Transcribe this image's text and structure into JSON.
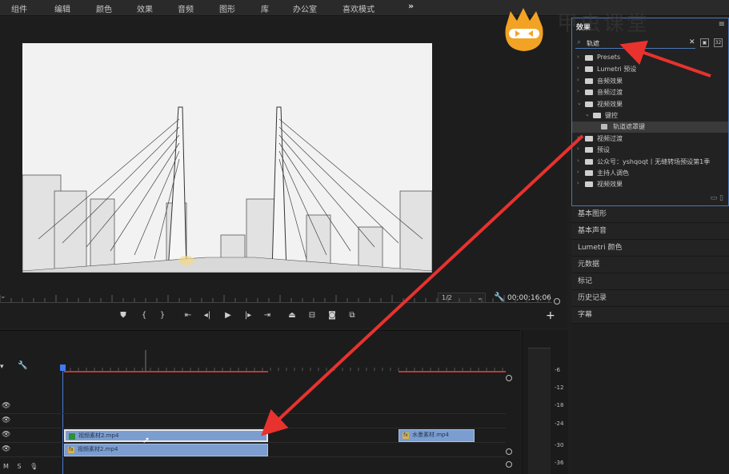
{
  "menu": {
    "items": [
      "组件",
      "编辑",
      "颜色",
      "效果",
      "音频",
      "图形",
      "库",
      "办公室",
      "喜欢模式"
    ],
    "more": "»"
  },
  "monitor": {
    "timecode": "00;00;16;06",
    "resolution": "1/2",
    "resolution_options_visible": "1/2",
    "transport_buttons": [
      "marker-icon",
      "in-point-icon",
      "out-point-icon",
      "go-to-in-icon",
      "step-back-icon",
      "play-icon",
      "step-forward-icon",
      "go-to-out-icon",
      "lift-icon",
      "extract-icon",
      "camera-icon",
      "compare-icon"
    ],
    "add": "+"
  },
  "timeline": {
    "clips": [
      {
        "label": "视频素材2.mp4",
        "track": "V1"
      },
      {
        "label": "视频素材2.mp4",
        "track": "A1"
      },
      {
        "label": "水墨素材.mp4",
        "track": "V1"
      }
    ],
    "track_labels": {
      "m": "M",
      "s": "S"
    }
  },
  "meter": {
    "db_labels": [
      "-6",
      "-12",
      "-18",
      "-24",
      "-30",
      "-36"
    ]
  },
  "effects": {
    "title": "效果",
    "search_value": "轨遮",
    "tree": [
      {
        "label": "Presets",
        "level": 0,
        "expanded": false
      },
      {
        "label": "Lumetri 预设",
        "level": 0,
        "expanded": false
      },
      {
        "label": "音频效果",
        "level": 0,
        "expanded": false
      },
      {
        "label": "音频过渡",
        "level": 0,
        "expanded": false
      },
      {
        "label": "视频效果",
        "level": 0,
        "expanded": true
      },
      {
        "label": "键控",
        "level": 1,
        "expanded": true
      },
      {
        "label": "轨道遮罩键",
        "level": 2,
        "selected": true
      },
      {
        "label": "视频过渡",
        "level": 0,
        "expanded": false
      },
      {
        "label": "预设",
        "level": 0,
        "expanded": false
      },
      {
        "label": "公众号：yshqoqt丨无缝转场预设第1季",
        "level": 0,
        "expanded": false
      },
      {
        "label": "主持人调色",
        "level": 0,
        "expanded": false
      },
      {
        "label": "视频效果",
        "level": 0,
        "expanded": false
      }
    ]
  },
  "side_panels": [
    "基本图形",
    "基本声音",
    "Lumetri 颜色",
    "元数据",
    "标记",
    "历史记录",
    "字幕"
  ],
  "watermark": {
    "text": "甲虫课堂"
  },
  "colors": {
    "accent": "#4a78b8",
    "annotation": "#e8322e",
    "clip": "#7c9dd0"
  }
}
